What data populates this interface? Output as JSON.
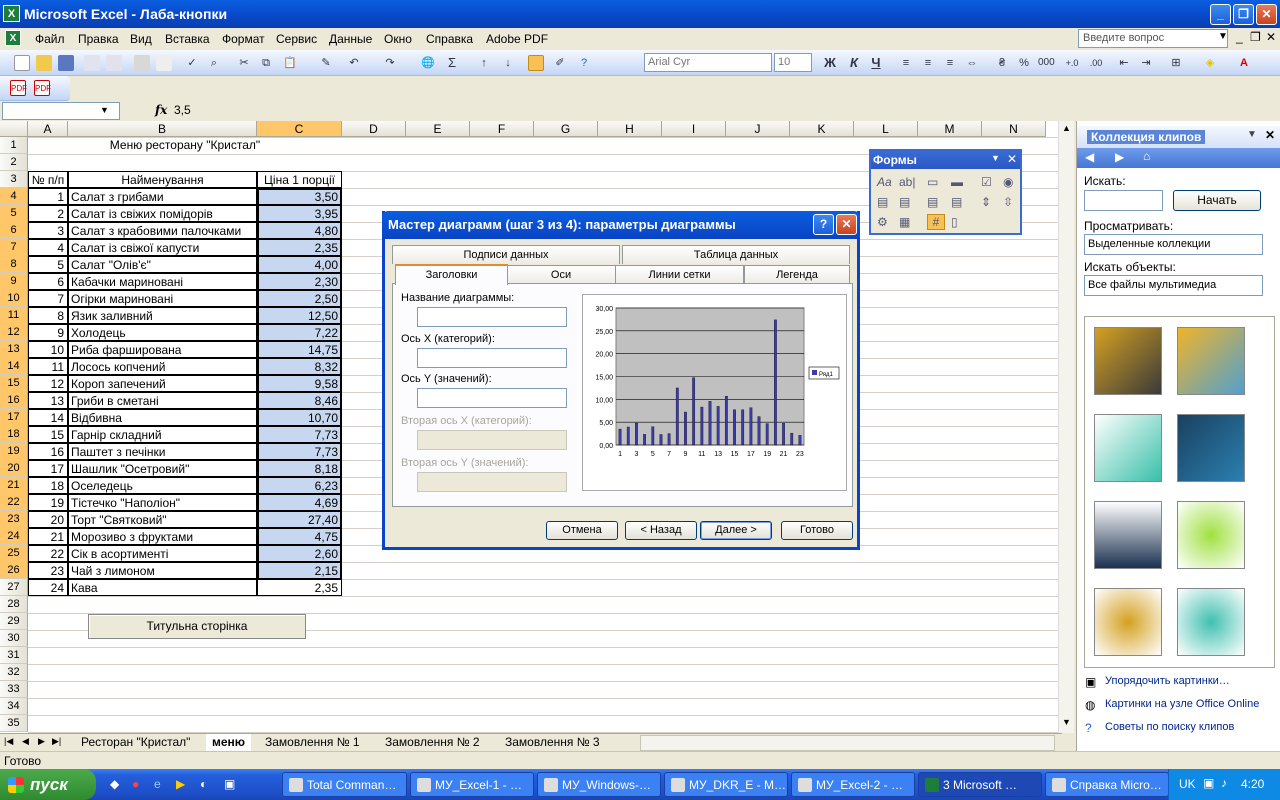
{
  "window": {
    "title": "Microsoft Excel - Лаба-кнопки",
    "min": "_",
    "max": "❐",
    "close": "✕"
  },
  "menu": {
    "items": [
      "Файл",
      "Правка",
      "Вид",
      "Вставка",
      "Формат",
      "Сервис",
      "Данные",
      "Окно",
      "Справка",
      "Adobe PDF"
    ],
    "help_placeholder": "Введите вопрос"
  },
  "toolbar": {
    "font": "Arial Cyr",
    "size": "10",
    "bold": "Ж",
    "italic": "К",
    "underline": "Ч",
    "percent": "%",
    "thousands": "000",
    "sum": "Σ"
  },
  "formula_bar": {
    "fx": "fx",
    "value": "3,5"
  },
  "columns": [
    "A",
    "B",
    "C",
    "D",
    "E",
    "F",
    "G",
    "H",
    "I",
    "J",
    "K",
    "L",
    "M",
    "N"
  ],
  "rows": [
    "1",
    "2",
    "3",
    "4",
    "5",
    "6",
    "7",
    "8",
    "9",
    "10",
    "11",
    "12",
    "13",
    "14",
    "15",
    "16",
    "17",
    "18",
    "19",
    "20",
    "21",
    "22",
    "23",
    "24",
    "25",
    "26",
    "27",
    "28",
    "29",
    "30",
    "31",
    "32",
    "33",
    "34",
    "35"
  ],
  "sheet": {
    "title": "Меню ресторану \"Кристал\"",
    "headers": [
      "№ п/п",
      "Найменування",
      "Ціна 1 порції"
    ],
    "items": [
      [
        "1",
        "Салат з грибами",
        "3,50"
      ],
      [
        "2",
        "Салат із свіжих помідорів",
        "3,95"
      ],
      [
        "3",
        "Салат з крабовими палочками",
        "4,80"
      ],
      [
        "4",
        "Салат із свіжої капусти",
        "2,35"
      ],
      [
        "5",
        "Салат \"Олів'є\"",
        "4,00"
      ],
      [
        "6",
        "Кабачки мариновані",
        "2,30"
      ],
      [
        "7",
        "Огірки мариновані",
        "2,50"
      ],
      [
        "8",
        "Язик заливний",
        "12,50"
      ],
      [
        "9",
        "Холодець",
        "7,22"
      ],
      [
        "10",
        "Риба фарширована",
        "14,75"
      ],
      [
        "11",
        "Лосось копчений",
        "8,32"
      ],
      [
        "12",
        "Короп запечений",
        "9,58"
      ],
      [
        "13",
        "Гриби в сметані",
        "8,46"
      ],
      [
        "14",
        "Відбивна",
        "10,70"
      ],
      [
        "15",
        "Гарнір складний",
        "7,73"
      ],
      [
        "16",
        "Паштет з печінки",
        "7,73"
      ],
      [
        "17",
        "Шашлик \"Осетровий\"",
        "8,18"
      ],
      [
        "18",
        "Оселедець",
        "6,23"
      ],
      [
        "19",
        "Тістечко \"Наполіон\"",
        "4,69"
      ],
      [
        "20",
        "Торт \"Святковий\"",
        "27,40"
      ],
      [
        "21",
        "Морозиво з фруктами",
        "4,75"
      ],
      [
        "22",
        "Сік в асортименті",
        "2,60"
      ],
      [
        "23",
        "Чай з лимоном",
        "2,15"
      ],
      [
        "24",
        "Кава",
        "2,35"
      ]
    ],
    "button": "Титульна сторінка"
  },
  "tabs": [
    "Ресторан \"Кристал\"",
    "меню",
    "Замовлення № 1",
    "Замовлення № 2",
    "Замовлення № 3"
  ],
  "status": "Готово",
  "forms_toolbar": {
    "title": "Формы"
  },
  "wizard": {
    "title": "Мастер диаграмм (шаг 3 из 4): параметры диаграммы",
    "tabs_back": [
      "Подписи данных",
      "Таблица данных"
    ],
    "tabs_front": [
      "Заголовки",
      "Оси",
      "Линии сетки",
      "Легенда"
    ],
    "fields": [
      {
        "label": "Название диаграммы:",
        "disabled": false
      },
      {
        "label": "Ось X (категорий):",
        "disabled": false
      },
      {
        "label": "Ось Y (значений):",
        "disabled": false
      },
      {
        "label": "Вторая ось X (категорий):",
        "disabled": true
      },
      {
        "label": "Вторая ось Y (значений):",
        "disabled": true
      }
    ],
    "buttons": [
      "Отмена",
      "< Назад",
      "Далее >",
      "Готово"
    ],
    "help": "?",
    "close": "✕"
  },
  "chart_data": {
    "type": "bar",
    "categories": [
      "1",
      "2",
      "3",
      "4",
      "5",
      "6",
      "7",
      "8",
      "9",
      "10",
      "11",
      "12",
      "13",
      "14",
      "15",
      "16",
      "17",
      "18",
      "19",
      "20",
      "21",
      "22",
      "23"
    ],
    "series": [
      {
        "name": "Ряд1",
        "values": [
          3.5,
          3.95,
          4.8,
          2.35,
          4.0,
          2.3,
          2.5,
          12.5,
          7.22,
          14.75,
          8.32,
          9.58,
          8.46,
          10.7,
          7.73,
          7.73,
          8.18,
          6.23,
          4.69,
          27.4,
          4.75,
          2.6,
          2.15
        ]
      }
    ],
    "x_tick_labels": [
      "1",
      "3",
      "5",
      "7",
      "9",
      "11",
      "13",
      "15",
      "17",
      "19",
      "21",
      "23"
    ],
    "y_tick_labels": [
      "0,00",
      "5,00",
      "10,00",
      "15,00",
      "20,00",
      "25,00",
      "30,00"
    ],
    "ylim": [
      0,
      30
    ],
    "grid": true,
    "legend": "right",
    "colors": {
      "bar": "#3c3ca8",
      "plot_bg": "#c0c0c0"
    }
  },
  "clip_pane": {
    "title": "Коллекция клипов",
    "search_label": "Искать:",
    "search_value": "",
    "start_button": "Начать",
    "browse_label": "Просматривать:",
    "browse_value": "Выделенные коллекции",
    "objects_label": "Искать объекты:",
    "objects_value": "Все файлы мультимедиа",
    "links": [
      "Упорядочить картинки…",
      "Картинки на узле Office Online",
      "Советы по поиску клипов"
    ]
  },
  "taskbar": {
    "start": "пуск",
    "tasks": [
      "Total Comman…",
      "МУ_Excel-1 - …",
      "МУ_Windows-…",
      "МУ_DKR_E - M…",
      "МУ_Excel-2 - …",
      "3 Microsoft …",
      "Справка Micro…"
    ],
    "lang": "UK",
    "clock": "4:20"
  }
}
